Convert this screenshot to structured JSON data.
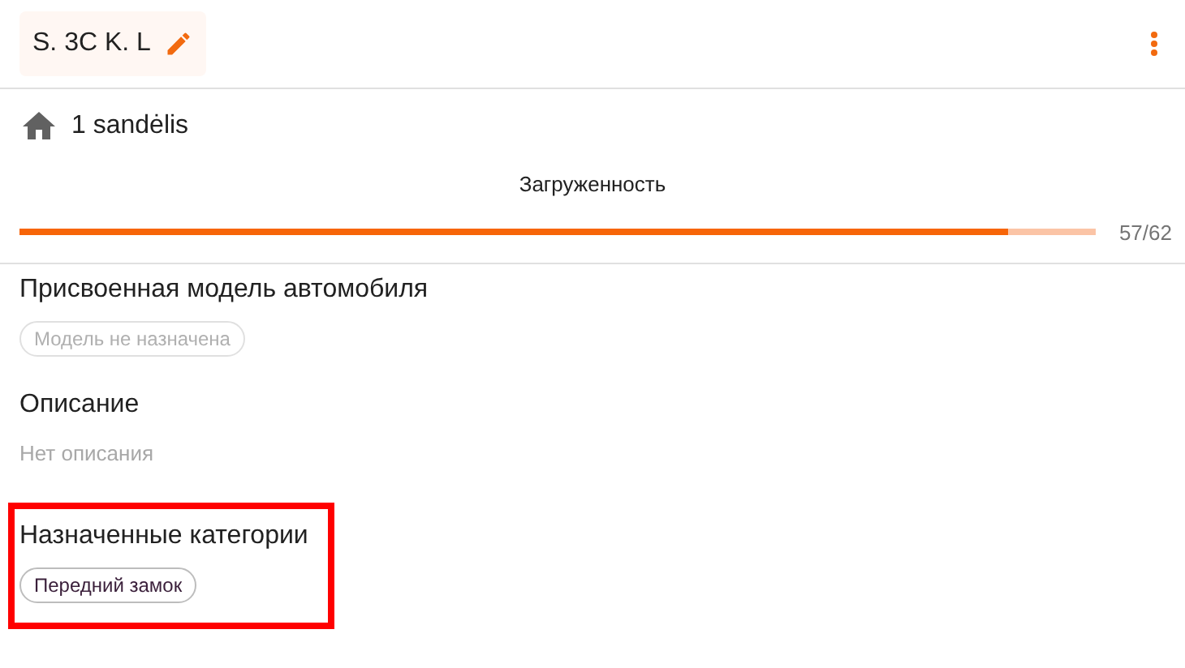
{
  "header": {
    "title": "S. 3C K. L"
  },
  "location": {
    "label": "1 sandėlis"
  },
  "load": {
    "label": "Загруженность",
    "level": 0.919,
    "reading": "57/62"
  },
  "sections": [
    {
      "title": "Присвоенная модель автомобиля",
      "kind": "chip",
      "value": "Модель не назначена",
      "empty": true,
      "highlighted": false
    },
    {
      "title": "Описание",
      "kind": "note",
      "value": "Нет описания",
      "empty": true,
      "highlighted": false
    },
    {
      "title": "Назначенные категории",
      "kind": "chip",
      "value": "Передний замок",
      "empty": false,
      "highlighted": true
    }
  ]
}
